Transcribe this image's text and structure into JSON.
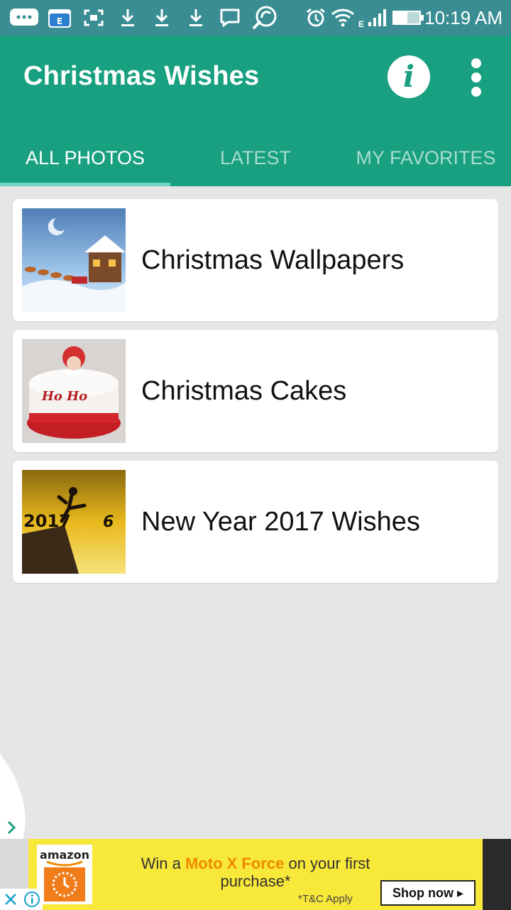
{
  "status_bar": {
    "time": "10:19 AM",
    "network_type": "E",
    "icons": [
      "chat-bubble-icon",
      "file-manager-icon",
      "screenshot-icon",
      "download-icon",
      "download-icon",
      "download-icon",
      "message-icon",
      "app-icon",
      "alarm-icon",
      "wifi-icon",
      "signal-icon",
      "battery-icon"
    ]
  },
  "app_bar": {
    "title": "Christmas Wishes",
    "info_icon": "i",
    "tabs": [
      {
        "label": "ALL PHOTOS",
        "active": true
      },
      {
        "label": "LATEST",
        "active": false
      },
      {
        "label": "MY FAVORITES",
        "active": false
      }
    ],
    "colors": {
      "primary": "#18a080",
      "status_bar": "#3a8e93",
      "tab_indicator": "#6fd6c8"
    }
  },
  "categories": [
    {
      "label": "Christmas Wallpapers",
      "thumbnail": "santa-sleigh-winter-image"
    },
    {
      "label": "Christmas Cakes",
      "thumbnail": "ho-ho-cake-image"
    },
    {
      "label": "New Year 2017 Wishes",
      "thumbnail": "new-year-2017-silhouette-image"
    }
  ],
  "ad": {
    "brand": "amazon",
    "text_before": "Win a",
    "text_highlight": "Moto X Force",
    "text_after": "on your first purchase*",
    "terms": "*T&C Apply",
    "cta": "Shop now ▸",
    "close_icon": "close-icon",
    "info_icon": "info-icon"
  }
}
